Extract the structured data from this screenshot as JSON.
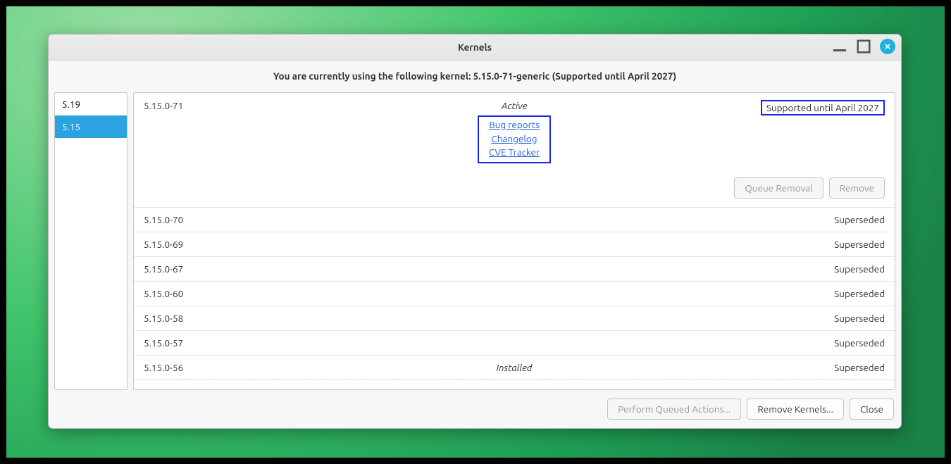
{
  "window": {
    "title": "Kernels",
    "subtitle": "You are currently using the following kernel: 5.15.0-71-generic (Supported until April 2027)"
  },
  "sidebar": {
    "items": [
      {
        "label": "5.19",
        "selected": false
      },
      {
        "label": "5.15",
        "selected": true
      }
    ]
  },
  "expanded": {
    "version": "5.15.0-71",
    "status": "Active",
    "support": "Supported until April 2027",
    "links": {
      "bug_reports": "Bug reports",
      "changelog": "Changelog",
      "cve_tracker": "CVE Tracker"
    },
    "queue_removal": "Queue Removal",
    "remove": "Remove"
  },
  "rows": [
    {
      "version": "5.15.0-70",
      "center": "",
      "right": "Superseded"
    },
    {
      "version": "5.15.0-69",
      "center": "",
      "right": "Superseded"
    },
    {
      "version": "5.15.0-67",
      "center": "",
      "right": "Superseded"
    },
    {
      "version": "5.15.0-60",
      "center": "",
      "right": "Superseded"
    },
    {
      "version": "5.15.0-58",
      "center": "",
      "right": "Superseded"
    },
    {
      "version": "5.15.0-57",
      "center": "",
      "right": "Superseded"
    },
    {
      "version": "5.15.0-56",
      "center": "Installed",
      "right": "Superseded"
    }
  ],
  "footer": {
    "perform": "Perform Queued Actions...",
    "remove_kernels": "Remove Kernels...",
    "close": "Close"
  }
}
